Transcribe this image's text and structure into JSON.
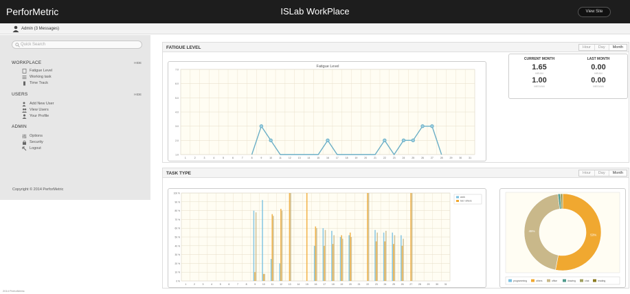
{
  "header": {
    "brand": "PerforMetric",
    "title": "ISLab WorkPlace",
    "view_site": "View Site"
  },
  "userbar": {
    "text": "Admin (3 Messages)"
  },
  "sidebar": {
    "search_placeholder": "Quick Search",
    "sections": [
      {
        "title": "WORKPLACE",
        "hide": "HIDE",
        "items": [
          "Fatigue Level",
          "Working task",
          "Time Track"
        ]
      },
      {
        "title": "USERS",
        "hide": "HIDE",
        "items": [
          "Add New User",
          "View Users",
          "Your Profile"
        ]
      },
      {
        "title": "ADMIN",
        "items": [
          "Options",
          "Security",
          "Logout"
        ]
      }
    ],
    "copyright": "Copyright © 2014 PerforMetric"
  },
  "fatigue": {
    "title": "FATIGUE LEVEL",
    "tabs": [
      "Hour",
      "Day",
      "Month"
    ],
    "active_tab": "Month",
    "stats": {
      "current_label": "CURRENT MONTH",
      "last_label": "LAST MONTH",
      "current_mean": "1.65",
      "current_median": "1.00",
      "last_mean": "0.00",
      "last_median": "0.00",
      "mean_label": "MEAN",
      "median_label": "MEDIAN"
    }
  },
  "task": {
    "title": "TASK TYPE",
    "tabs": [
      "Hour",
      "Day",
      "Month"
    ],
    "active_tab": "Month"
  },
  "footer": "2014 PerforMetric",
  "chart_data": [
    {
      "type": "line",
      "title": "Fatigue Level",
      "x": [
        1,
        2,
        3,
        4,
        5,
        6,
        7,
        8,
        9,
        10,
        11,
        12,
        13,
        14,
        15,
        16,
        17,
        18,
        19,
        20,
        21,
        22,
        23,
        24,
        25,
        26,
        27,
        28,
        29,
        30,
        31
      ],
      "values": [
        null,
        null,
        null,
        null,
        null,
        null,
        null,
        1,
        3,
        2,
        1,
        1,
        1,
        1,
        1,
        2,
        1,
        1,
        1,
        1,
        1,
        2,
        1,
        2,
        2,
        3,
        3,
        1,
        null,
        null,
        null
      ],
      "ylim": [
        1,
        7
      ],
      "yticks": [
        "1.0",
        "2.0",
        "3.0",
        "4.0",
        "5.0",
        "6.0",
        "7.0"
      ],
      "color": "#6aaec6",
      "grid": true
    },
    {
      "type": "bar",
      "categories": [
        "1",
        "2",
        "3",
        "4",
        "5",
        "6",
        "7",
        "8",
        "9",
        "10",
        "11",
        "12",
        "13",
        "14",
        "15",
        "16",
        "17",
        "18",
        "19",
        "20",
        "21",
        "22",
        "23",
        "24",
        "25",
        "26",
        "27",
        "28",
        "29",
        "30",
        "31"
      ],
      "series": [
        {
          "name": "work",
          "color": "#77bfe0",
          "values": [
            0,
            0,
            0,
            0,
            0,
            0,
            0,
            0,
            80,
            92,
            25,
            20,
            0,
            0,
            0,
            40,
            60,
            57,
            50,
            52,
            0,
            0,
            58,
            55,
            55,
            52,
            0,
            0,
            0,
            0,
            0
          ]
        },
        {
          "name": "bet / others",
          "color": "#f0a830",
          "values": [
            0,
            0,
            0,
            0,
            0,
            0,
            0,
            0,
            10,
            8,
            76,
            82,
            100,
            0,
            100,
            62,
            40,
            42,
            52,
            55,
            0,
            100,
            45,
            45,
            42,
            40,
            100,
            0,
            0,
            0,
            0
          ]
        },
        {
          "name": "other",
          "color": "#c9b88a",
          "values": [
            0,
            0,
            0,
            0,
            0,
            0,
            0,
            0,
            78,
            8,
            74,
            80,
            100,
            0,
            0,
            60,
            58,
            52,
            48,
            50,
            0,
            100,
            55,
            57,
            52,
            48,
            100,
            0,
            0,
            0,
            0
          ]
        }
      ],
      "ylim": [
        0,
        100
      ],
      "yticks": [
        "0 %",
        "10 %",
        "20 %",
        "30 %",
        "40 %",
        "50 %",
        "60 %",
        "70 %",
        "80 %",
        "90 %",
        "100 %"
      ],
      "legend": "top-right"
    },
    {
      "type": "pie",
      "labels": [
        "programming",
        "others",
        "office",
        "drawing",
        "chat",
        "reading"
      ],
      "values": [
        0,
        53,
        45,
        1,
        1,
        0
      ],
      "colors": [
        "#77bfe0",
        "#f0a830",
        "#c9b88a",
        "#4f9a8c",
        "#a0a060",
        "#8a7a20"
      ],
      "slice_labels": {
        "others": "53%",
        "office": "45%"
      }
    }
  ]
}
